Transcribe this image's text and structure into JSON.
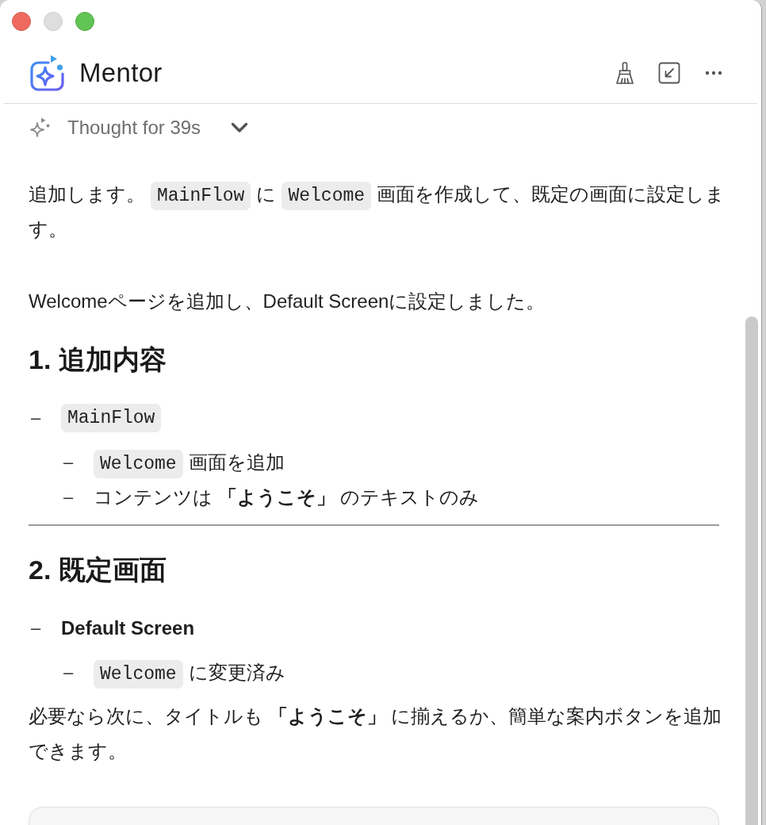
{
  "window": {
    "buttons": [
      {
        "kind": "close",
        "disabled": false
      },
      {
        "kind": "minimize",
        "disabled": true
      },
      {
        "kind": "zoom",
        "disabled": false
      }
    ]
  },
  "header": {
    "title": "Mentor",
    "actions": [
      {
        "kind": "clear"
      },
      {
        "kind": "collapse"
      },
      {
        "kind": "more"
      }
    ]
  },
  "thought": {
    "label": "Thought for 39s",
    "expanded": false
  },
  "message": {
    "blocks": [
      {
        "kind": "paragraph",
        "parts": [
          {
            "kind": "text",
            "text": "追加します。"
          },
          {
            "kind": "code",
            "text": "MainFlow"
          },
          {
            "kind": "text",
            "text": "に"
          },
          {
            "kind": "code",
            "text": "Welcome"
          },
          {
            "kind": "text",
            "text": "画面を作成して、既定の画面に設定します。"
          }
        ]
      },
      {
        "kind": "paragraph",
        "parts": [
          {
            "kind": "text",
            "text": "Welcomeページを追加し、Default Screenに設定しました。"
          }
        ]
      },
      {
        "kind": "heading",
        "text": "1. 追加内容"
      },
      {
        "kind": "list",
        "items": [
          {
            "marker": "–",
            "parts": [
              {
                "kind": "code",
                "text": "MainFlow"
              }
            ],
            "children": [
              {
                "marker": "–",
                "parts": [
                  {
                    "kind": "code",
                    "text": "Welcome"
                  },
                  {
                    "kind": "text",
                    "text": "画面を追加"
                  }
                ]
              },
              {
                "marker": "–",
                "parts": [
                  {
                    "kind": "text",
                    "text": "コンテンツは **「ようこそ」** のテキストのみ"
                  }
                ]
              }
            ]
          }
        ]
      },
      {
        "kind": "rule"
      },
      {
        "kind": "heading",
        "text": "2. 既定画面"
      },
      {
        "kind": "list",
        "items": [
          {
            "marker": "–",
            "parts": [
              {
                "kind": "strong",
                "text": "Default Screen"
              }
            ],
            "children": [
              {
                "marker": "–",
                "parts": [
                  {
                    "kind": "code",
                    "text": "Welcome"
                  },
                  {
                    "kind": "text",
                    "text": "に変更済み"
                  }
                ]
              }
            ]
          }
        ]
      },
      {
        "kind": "paragraph",
        "parts": [
          {
            "kind": "text",
            "text": "必要なら次に、タイトルも **「ようこそ」** に揃えるか、簡単な案内ボタンを追加できます。"
          }
        ]
      },
      {
        "kind": "card"
      }
    ]
  }
}
